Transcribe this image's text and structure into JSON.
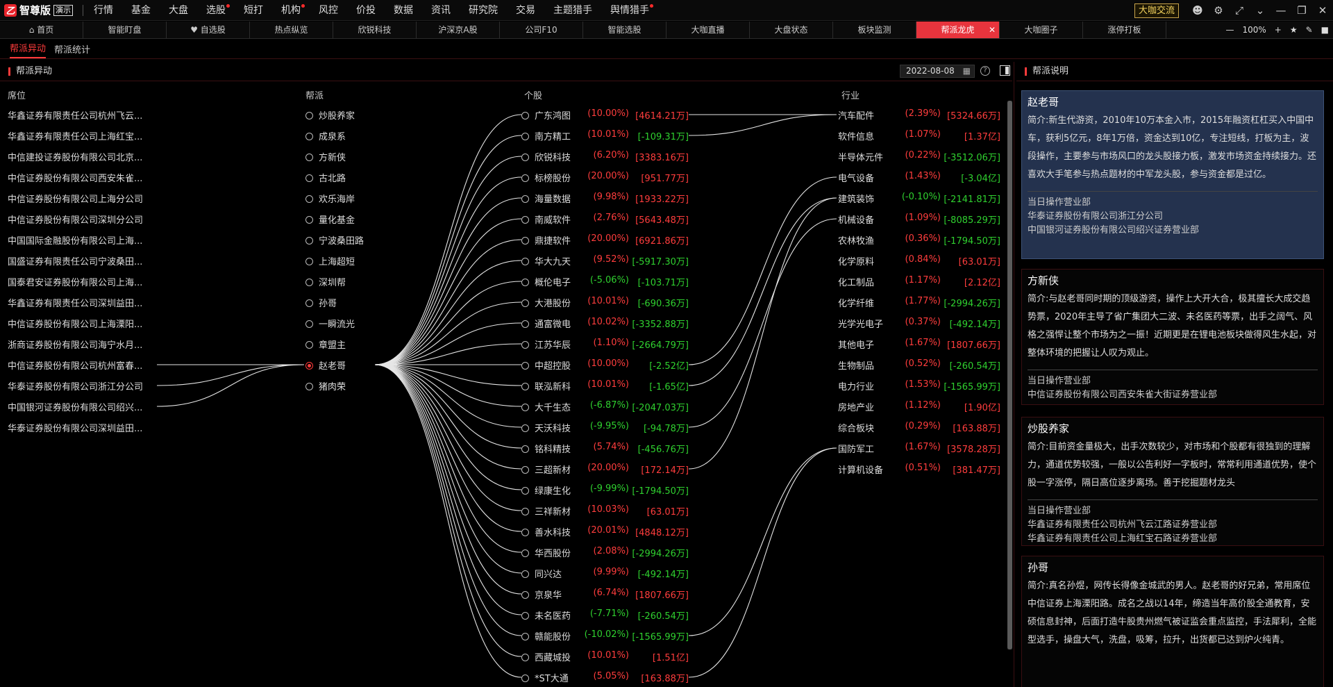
{
  "app": {
    "name": "智尊版",
    "mode_badge": "演示"
  },
  "menu": [
    {
      "label": "行情",
      "dot": false
    },
    {
      "label": "基金",
      "dot": false
    },
    {
      "label": "大盘",
      "dot": false
    },
    {
      "label": "选股",
      "dot": true
    },
    {
      "label": "短打",
      "dot": false
    },
    {
      "label": "机构",
      "dot": true
    },
    {
      "label": "风控",
      "dot": false
    },
    {
      "label": "价投",
      "dot": false
    },
    {
      "label": "数据",
      "dot": false
    },
    {
      "label": "资讯",
      "dot": false
    },
    {
      "label": "研究院",
      "dot": false
    },
    {
      "label": "交易",
      "dot": false
    },
    {
      "label": "主题猎手",
      "dot": false
    },
    {
      "label": "舆情猎手",
      "dot": true
    }
  ],
  "top_right": {
    "coffee_label": "大咖交流"
  },
  "tabs": [
    {
      "label": "首页",
      "icon": "home-icon"
    },
    {
      "label": "智能盯盘"
    },
    {
      "label": "自选股",
      "icon": "heart-icon"
    },
    {
      "label": "热点纵览"
    },
    {
      "label": "欣锐科技"
    },
    {
      "label": "沪深京A股"
    },
    {
      "label": "公司F10"
    },
    {
      "label": "智能选股"
    },
    {
      "label": "大咖直播"
    },
    {
      "label": "大盘状态"
    },
    {
      "label": "板块监测"
    },
    {
      "label": "帮派龙虎",
      "active": true
    },
    {
      "label": "大咖圈子"
    },
    {
      "label": "涨停打板"
    }
  ],
  "zoom": "100%",
  "subtabs": [
    {
      "label": "帮派异动",
      "active": true
    },
    {
      "label": "帮派统计",
      "active": false
    }
  ],
  "panel": {
    "title": "帮派异动",
    "date": "2022-08-08"
  },
  "headers": {
    "seat": "席位",
    "gang": "帮派",
    "stock": "个股",
    "industry": "行业"
  },
  "seats": [
    "华鑫证券有限责任公司杭州飞云...",
    "华鑫证券有限责任公司上海红宝...",
    "中信建投证券股份有限公司北京...",
    "中信证券股份有限公司西安朱雀...",
    "中信证券股份有限公司上海分公司",
    "中信证券股份有限公司深圳分公司",
    "中国国际金融股份有限公司上海...",
    "国盛证券有限责任公司宁波桑田...",
    "国泰君安证券股份有限公司上海...",
    "华鑫证券有限责任公司深圳益田...",
    "中信证券股份有限公司上海溧阳...",
    "浙商证券股份有限公司海宁水月...",
    "中信证券股份有限公司杭州富春...",
    "华泰证券股份有限公司浙江分公司",
    "中国银河证券股份有限公司绍兴...",
    "华泰证券股份有限公司深圳益田..."
  ],
  "gangs": [
    "炒股养家",
    "成泉系",
    "方新侠",
    "古北路",
    "欢乐海岸",
    "量化基金",
    "宁波桑田路",
    "上海超短",
    "深圳帮",
    "孙哥",
    "一瞬流光",
    "章盟主",
    "赵老哥",
    "猪肉荣"
  ],
  "selected_gang_index": 12,
  "stocks": [
    {
      "name": "广东鸿图",
      "pct": "(10.00%)",
      "amt": "[4614.21万]",
      "pct_up": true,
      "amt_up": true
    },
    {
      "name": "南方精工",
      "pct": "(10.01%)",
      "amt": "[-109.31万]",
      "pct_up": true,
      "amt_up": false
    },
    {
      "name": "欣锐科技",
      "pct": "(6.20%)",
      "amt": "[3383.16万]",
      "pct_up": true,
      "amt_up": true
    },
    {
      "name": "标榜股份",
      "pct": "(20.00%)",
      "amt": "[951.77万]",
      "pct_up": true,
      "amt_up": true
    },
    {
      "name": "海量数据",
      "pct": "(9.98%)",
      "amt": "[1933.22万]",
      "pct_up": true,
      "amt_up": true
    },
    {
      "name": "南威软件",
      "pct": "(2.76%)",
      "amt": "[5643.48万]",
      "pct_up": true,
      "amt_up": true
    },
    {
      "name": "鼎捷软件",
      "pct": "(20.00%)",
      "amt": "[6921.86万]",
      "pct_up": true,
      "amt_up": true
    },
    {
      "name": "华大九天",
      "pct": "(9.52%)",
      "amt": "[-5917.30万]",
      "pct_up": true,
      "amt_up": false
    },
    {
      "name": "概伦电子",
      "pct": "(-5.06%)",
      "amt": "[-103.71万]",
      "pct_up": false,
      "amt_up": false
    },
    {
      "name": "大港股份",
      "pct": "(10.01%)",
      "amt": "[-690.36万]",
      "pct_up": true,
      "amt_up": false
    },
    {
      "name": "通富微电",
      "pct": "(10.02%)",
      "amt": "[-3352.88万]",
      "pct_up": true,
      "amt_up": false
    },
    {
      "name": "江苏华辰",
      "pct": "(1.10%)",
      "amt": "[-2664.79万]",
      "pct_up": true,
      "amt_up": false
    },
    {
      "name": "中超控股",
      "pct": "(10.00%)",
      "amt": "[-2.52亿]",
      "pct_up": true,
      "amt_up": false
    },
    {
      "name": "联泓新科",
      "pct": "(10.01%)",
      "amt": "[-1.65亿]",
      "pct_up": true,
      "amt_up": false
    },
    {
      "name": "大千生态",
      "pct": "(-6.87%)",
      "amt": "[-2047.03万]",
      "pct_up": false,
      "amt_up": false
    },
    {
      "name": "天沃科技",
      "pct": "(-9.95%)",
      "amt": "[-94.78万]",
      "pct_up": false,
      "amt_up": false
    },
    {
      "name": "铭科精技",
      "pct": "(5.74%)",
      "amt": "[-456.76万]",
      "pct_up": true,
      "amt_up": false
    },
    {
      "name": "三超新材",
      "pct": "(20.00%)",
      "amt": "[172.14万]",
      "pct_up": true,
      "amt_up": true
    },
    {
      "name": "绿康生化",
      "pct": "(-9.99%)",
      "amt": "[-1794.50万]",
      "pct_up": false,
      "amt_up": false
    },
    {
      "name": "三祥新材",
      "pct": "(10.03%)",
      "amt": "[63.01万]",
      "pct_up": true,
      "amt_up": true
    },
    {
      "name": "善水科技",
      "pct": "(20.01%)",
      "amt": "[4848.12万]",
      "pct_up": true,
      "amt_up": true
    },
    {
      "name": "华西股份",
      "pct": "(2.08%)",
      "amt": "[-2994.26万]",
      "pct_up": true,
      "amt_up": false
    },
    {
      "name": "同兴达",
      "pct": "(9.99%)",
      "amt": "[-492.14万]",
      "pct_up": true,
      "amt_up": false
    },
    {
      "name": "京泉华",
      "pct": "(6.74%)",
      "amt": "[1807.66万]",
      "pct_up": true,
      "amt_up": true
    },
    {
      "name": "未名医药",
      "pct": "(-7.71%)",
      "amt": "[-260.54万]",
      "pct_up": false,
      "amt_up": false
    },
    {
      "name": "赣能股份",
      "pct": "(-10.02%)",
      "amt": "[-1565.99万]",
      "pct_up": false,
      "amt_up": false
    },
    {
      "name": "西藏城投",
      "pct": "(10.01%)",
      "amt": "[1.51亿]",
      "pct_up": true,
      "amt_up": true
    },
    {
      "name": "*ST大通",
      "pct": "(5.05%)",
      "amt": "[163.88万]",
      "pct_up": true,
      "amt_up": true
    }
  ],
  "industries": [
    {
      "name": "汽车配件",
      "pct": "(2.39%)",
      "amt": "[5324.66万]",
      "pct_up": true,
      "amt_up": true
    },
    {
      "name": "软件信息",
      "pct": "(1.07%)",
      "amt": "[1.37亿]",
      "pct_up": true,
      "amt_up": true
    },
    {
      "name": "半导体元件",
      "pct": "(0.22%)",
      "amt": "[-3512.06万]",
      "pct_up": true,
      "amt_up": false
    },
    {
      "name": "电气设备",
      "pct": "(1.43%)",
      "amt": "[-3.04亿]",
      "pct_up": true,
      "amt_up": false
    },
    {
      "name": "建筑装饰",
      "pct": "(-0.10%)",
      "amt": "[-2141.81万]",
      "pct_up": false,
      "amt_up": false
    },
    {
      "name": "机械设备",
      "pct": "(1.09%)",
      "amt": "[-8085.29万]",
      "pct_up": true,
      "amt_up": false
    },
    {
      "name": "农林牧渔",
      "pct": "(0.36%)",
      "amt": "[-1794.50万]",
      "pct_up": true,
      "amt_up": false
    },
    {
      "name": "化学原料",
      "pct": "(0.84%)",
      "amt": "[63.01万]",
      "pct_up": true,
      "amt_up": true
    },
    {
      "name": "化工制品",
      "pct": "(1.17%)",
      "amt": "[2.12亿]",
      "pct_up": true,
      "amt_up": true
    },
    {
      "name": "化学纤维",
      "pct": "(1.77%)",
      "amt": "[-2994.26万]",
      "pct_up": true,
      "amt_up": false
    },
    {
      "name": "光学光电子",
      "pct": "(0.37%)",
      "amt": "[-492.14万]",
      "pct_up": true,
      "amt_up": false
    },
    {
      "name": "其他电子",
      "pct": "(1.67%)",
      "amt": "[1807.66万]",
      "pct_up": true,
      "amt_up": true
    },
    {
      "name": "生物制品",
      "pct": "(0.52%)",
      "amt": "[-260.54万]",
      "pct_up": true,
      "amt_up": false
    },
    {
      "name": "电力行业",
      "pct": "(1.53%)",
      "amt": "[-1565.99万]",
      "pct_up": true,
      "amt_up": false
    },
    {
      "name": "房地产业",
      "pct": "(1.12%)",
      "amt": "[1.90亿]",
      "pct_up": true,
      "amt_up": true
    },
    {
      "name": "综合板块",
      "pct": "(0.29%)",
      "amt": "[163.88万]",
      "pct_up": true,
      "amt_up": true
    },
    {
      "name": "国防军工",
      "pct": "(1.67%)",
      "amt": "[3578.28万]",
      "pct_up": true,
      "amt_up": true
    },
    {
      "name": "计算机设备",
      "pct": "(0.51%)",
      "amt": "[381.47万]",
      "pct_up": true,
      "amt_up": true
    }
  ],
  "links": {
    "seat_to_gang": [
      12,
      13,
      14
    ],
    "stock_to_industry": [
      [
        0,
        0
      ],
      [
        1,
        0
      ],
      [
        12,
        3
      ],
      [
        13,
        4
      ],
      [
        15,
        5
      ],
      [
        17,
        4
      ],
      [
        25,
        16
      ],
      [
        27,
        16
      ]
    ]
  },
  "colors": {
    "up": "#ff3d3d",
    "down": "#2fd12f",
    "accent": "#e8343d",
    "active_card": "#24324e"
  },
  "right_panel": {
    "title": "帮派说明",
    "op_label": "当日操作营业部",
    "cards": [
      {
        "name": "赵老哥",
        "active": true,
        "desc": "简介:新生代游资，2010年10万本金入市，2015年融资杠杠买入中国中车，获利5亿元，8年1万倍，资金达到10亿，专注短线，打板为主，波段操作，主要参与市场风口的龙头股接力板，激发市场资金持续接力。还喜欢大手笔参与热点题材的中军龙头股，参与资金都是过亿。",
        "branches": [
          "华泰证券股份有限公司浙江分公司",
          "中国银河证券股份有限公司绍兴证券营业部"
        ]
      },
      {
        "name": "方新侠",
        "active": false,
        "desc": "简介:与赵老哥同时期的顶级游资，操作上大开大合，极其擅长大成交趋势票，2020年主导了省广集团大二波、未名医药等票，出手之阔气、风格之强悍让整个市场为之一振！近期更是在锂电池板块做得风生水起，对整体环境的把握让人叹为观止。",
        "branches": [
          "中信证券股份有限公司西安朱雀大街证券营业部"
        ]
      },
      {
        "name": "炒股养家",
        "active": false,
        "desc": "简介:目前资金量极大，出手次数较少，对市场和个股都有很独到的理解力，通道优势较强，一般以公告利好一字板时，常常利用通道优势，使个股一字涨停，隔日高位逐步离场。善于挖掘题材龙头",
        "branches": [
          "华鑫证券有限责任公司杭州飞云江路证券营业部",
          "华鑫证券有限责任公司上海红宝石路证券营业部"
        ]
      },
      {
        "name": "孙哥",
        "active": false,
        "desc": "简介:真名孙煜，网传长得像金城武的男人。赵老哥的好兄弟，常用席位中信证券上海溧阳路。成名之战以14年，缔造当年高价股全通教育，安硕信息封神，后面打造牛股贵州燃气被证监会重点监控，手法犀利，全能型选手，操盘大气，洗盘，吸筹，拉升，出货都已达到炉火纯青。",
        "branches": []
      }
    ]
  }
}
